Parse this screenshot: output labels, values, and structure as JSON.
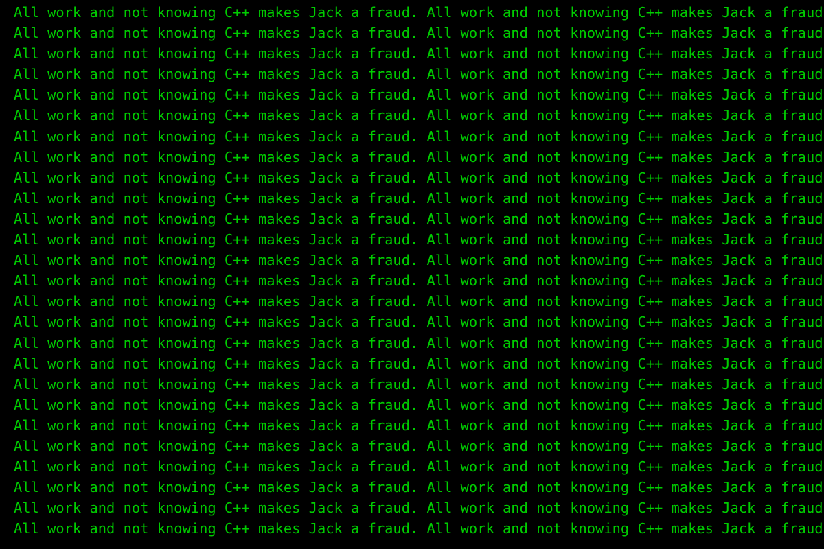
{
  "terminal": {
    "app_name": "terminal-window",
    "background_color": "#000000",
    "text_color": "#00cc00",
    "phrase": "All work and not knowing C++ makes Jack a fraud.",
    "separator": " ",
    "repeats_per_line": 2,
    "line_count": 26,
    "line_text": "All work and not knowing C++ makes Jack a fraud. All work and not knowing C++ makes Jack a fraud.",
    "lines": [
      "All work and not knowing C++ makes Jack a fraud. All work and not knowing C++ makes Jack a fraud.",
      "All work and not knowing C++ makes Jack a fraud. All work and not knowing C++ makes Jack a fraud.",
      "All work and not knowing C++ makes Jack a fraud. All work and not knowing C++ makes Jack a fraud.",
      "All work and not knowing C++ makes Jack a fraud. All work and not knowing C++ makes Jack a fraud.",
      "All work and not knowing C++ makes Jack a fraud. All work and not knowing C++ makes Jack a fraud.",
      "All work and not knowing C++ makes Jack a fraud. All work and not knowing C++ makes Jack a fraud.",
      "All work and not knowing C++ makes Jack a fraud. All work and not knowing C++ makes Jack a fraud.",
      "All work and not knowing C++ makes Jack a fraud. All work and not knowing C++ makes Jack a fraud.",
      "All work and not knowing C++ makes Jack a fraud. All work and not knowing C++ makes Jack a fraud.",
      "All work and not knowing C++ makes Jack a fraud. All work and not knowing C++ makes Jack a fraud.",
      "All work and not knowing C++ makes Jack a fraud. All work and not knowing C++ makes Jack a fraud.",
      "All work and not knowing C++ makes Jack a fraud. All work and not knowing C++ makes Jack a fraud.",
      "All work and not knowing C++ makes Jack a fraud. All work and not knowing C++ makes Jack a fraud.",
      "All work and not knowing C++ makes Jack a fraud. All work and not knowing C++ makes Jack a fraud.",
      "All work and not knowing C++ makes Jack a fraud. All work and not knowing C++ makes Jack a fraud.",
      "All work and not knowing C++ makes Jack a fraud. All work and not knowing C++ makes Jack a fraud.",
      "All work and not knowing C++ makes Jack a fraud. All work and not knowing C++ makes Jack a fraud.",
      "All work and not knowing C++ makes Jack a fraud. All work and not knowing C++ makes Jack a fraud.",
      "All work and not knowing C++ makes Jack a fraud. All work and not knowing C++ makes Jack a fraud.",
      "All work and not knowing C++ makes Jack a fraud. All work and not knowing C++ makes Jack a fraud.",
      "All work and not knowing C++ makes Jack a fraud. All work and not knowing C++ makes Jack a fraud.",
      "All work and not knowing C++ makes Jack a fraud. All work and not knowing C++ makes Jack a fraud.",
      "All work and not knowing C++ makes Jack a fraud. All work and not knowing C++ makes Jack a fraud.",
      "All work and not knowing C++ makes Jack a fraud. All work and not knowing C++ makes Jack a fraud.",
      "All work and not knowing C++ makes Jack a fraud. All work and not knowing C++ makes Jack a fraud.",
      "All work and not knowing C++ makes Jack a fraud. All work and not knowing C++ makes Jack a fraud."
    ]
  }
}
